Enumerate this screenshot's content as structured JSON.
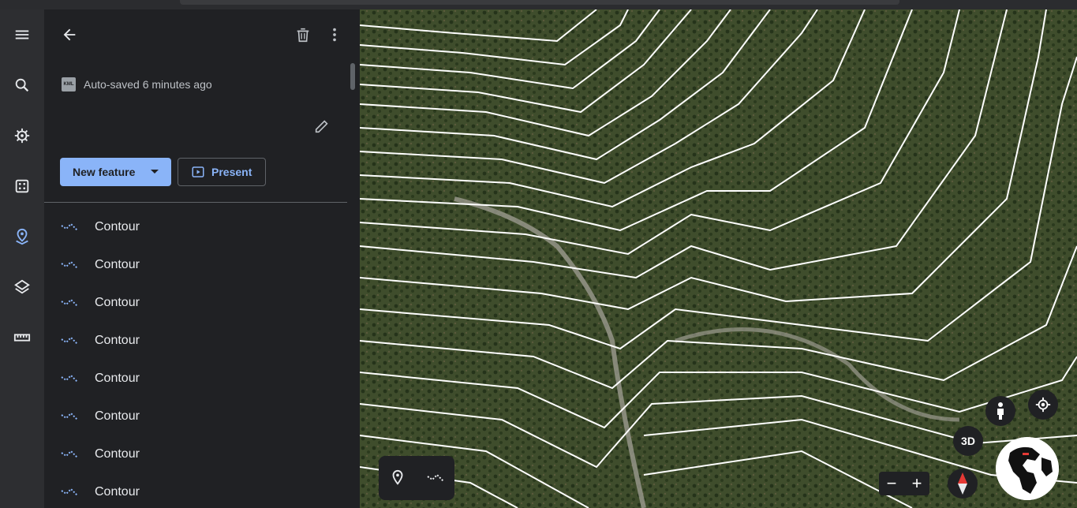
{
  "panel": {
    "autosave_text": "Auto-saved 6 minutes ago",
    "kml_badge": "KML",
    "new_feature_label": "New feature",
    "present_label": "Present"
  },
  "features": [
    {
      "label": "Contour"
    },
    {
      "label": "Contour"
    },
    {
      "label": "Contour"
    },
    {
      "label": "Contour"
    },
    {
      "label": "Contour"
    },
    {
      "label": "Contour"
    },
    {
      "label": "Contour"
    },
    {
      "label": "Contour"
    }
  ],
  "rail": {
    "items": [
      {
        "icon": "menu-icon"
      },
      {
        "icon": "search-icon"
      },
      {
        "icon": "voyager-icon"
      },
      {
        "icon": "feeling-lucky-icon"
      },
      {
        "icon": "projects-icon",
        "active": true
      },
      {
        "icon": "layers-icon"
      },
      {
        "icon": "measure-icon"
      }
    ]
  },
  "map": {
    "view_3d_label": "3D",
    "zoom_out": "−",
    "zoom_in": "+"
  },
  "colors": {
    "accent": "#8ab4f8",
    "panel_bg": "#202124",
    "rail_bg": "#2d2e31",
    "contour_line": "#ffffff"
  }
}
